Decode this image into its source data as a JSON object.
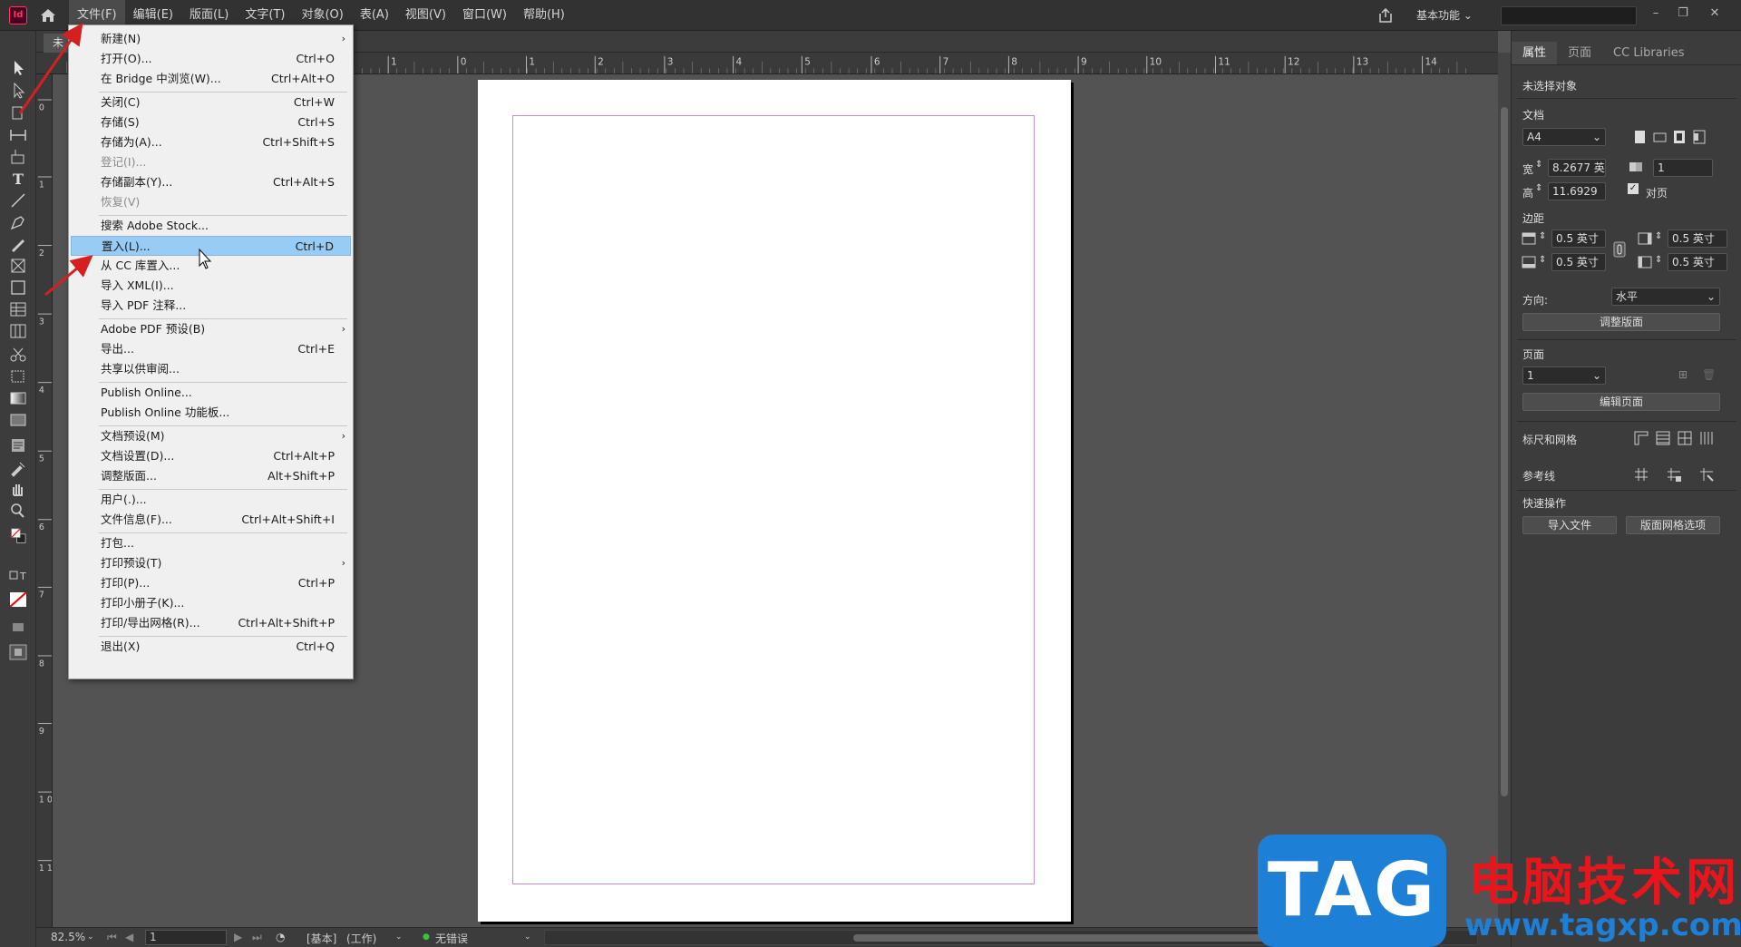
{
  "app": {
    "logo_text": "Id"
  },
  "menubar": {
    "items": [
      "文件(F)",
      "编辑(E)",
      "版面(L)",
      "文字(T)",
      "对象(O)",
      "表(A)",
      "视图(V)",
      "窗口(W)",
      "帮助(H)"
    ],
    "workspace": "基本功能"
  },
  "document_tab": "未",
  "file_menu": {
    "groups": [
      [
        {
          "label": "新建(N)",
          "shortcut": "",
          "submenu": true
        },
        {
          "label": "打开(O)...",
          "shortcut": "Ctrl+O"
        },
        {
          "label": "在 Bridge 中浏览(W)...",
          "shortcut": "Ctrl+Alt+O"
        }
      ],
      [
        {
          "label": "关闭(C)",
          "shortcut": "Ctrl+W"
        },
        {
          "label": "存储(S)",
          "shortcut": "Ctrl+S"
        },
        {
          "label": "存储为(A)...",
          "shortcut": "Ctrl+Shift+S"
        },
        {
          "label": "登记(I)...",
          "shortcut": "",
          "disabled": true
        },
        {
          "label": "存储副本(Y)...",
          "shortcut": "Ctrl+Alt+S"
        },
        {
          "label": "恢复(V)",
          "shortcut": "",
          "disabled": true
        }
      ],
      [
        {
          "label": "搜索 Adobe Stock...",
          "shortcut": ""
        },
        {
          "label": "置入(L)...",
          "shortcut": "Ctrl+D",
          "highlighted": true
        },
        {
          "label": "从 CC 库置入...",
          "shortcut": ""
        },
        {
          "label": "导入 XML(I)...",
          "shortcut": ""
        },
        {
          "label": "导入 PDF 注释...",
          "shortcut": ""
        }
      ],
      [
        {
          "label": "Adobe PDF 预设(B)",
          "shortcut": "",
          "submenu": true
        },
        {
          "label": "导出...",
          "shortcut": "Ctrl+E"
        },
        {
          "label": "共享以供审阅...",
          "shortcut": ""
        }
      ],
      [
        {
          "label": "Publish Online...",
          "shortcut": ""
        },
        {
          "label": "Publish Online 功能板...",
          "shortcut": ""
        }
      ],
      [
        {
          "label": "文档预设(M)",
          "shortcut": "",
          "submenu": true
        },
        {
          "label": "文档设置(D)...",
          "shortcut": "Ctrl+Alt+P"
        },
        {
          "label": "调整版面...",
          "shortcut": "Alt+Shift+P"
        }
      ],
      [
        {
          "label": "用户(.)...",
          "shortcut": ""
        },
        {
          "label": "文件信息(F)...",
          "shortcut": "Ctrl+Alt+Shift+I"
        }
      ],
      [
        {
          "label": "打包...",
          "shortcut": ""
        },
        {
          "label": "打印预设(T)",
          "shortcut": "",
          "submenu": true
        },
        {
          "label": "打印(P)...",
          "shortcut": "Ctrl+P"
        },
        {
          "label": "打印小册子(K)...",
          "shortcut": ""
        },
        {
          "label": "打印/导出网格(R)...",
          "shortcut": "Ctrl+Alt+Shift+P"
        }
      ],
      [
        {
          "label": "退出(X)",
          "shortcut": "Ctrl+Q"
        }
      ]
    ]
  },
  "rulers": {
    "horizontal": [
      "1",
      "0",
      "1",
      "2",
      "3",
      "4",
      "5",
      "6",
      "7",
      "8",
      "9",
      "10",
      "11",
      "12",
      "13",
      "14"
    ],
    "vertical": [
      "0",
      "1",
      "2",
      "3",
      "4",
      "5",
      "6",
      "7",
      "8",
      "9",
      "1 0",
      "1 1"
    ]
  },
  "panel": {
    "tabs": [
      "属性",
      "页面",
      "CC Libraries"
    ],
    "no_selection": "未选择对象",
    "document_label": "文档",
    "page_size": "A4",
    "width_label": "宽",
    "width_value": "8.2677 英",
    "height_label": "高",
    "height_value": "11.6929",
    "pages_value": "1",
    "facing_pages": "对页",
    "margins_label": "边距",
    "margin_top": "0.5 英寸",
    "margin_bottom": "0.5 英寸",
    "margin_right": "0.5 英寸",
    "margin_left": "0.5 英寸",
    "direction_label": "方向:",
    "direction_value": "水平",
    "adjust_layout": "调整版面",
    "page_label": "页面",
    "page_value": "1",
    "edit_page": "编辑页面",
    "rulers_grids": "标尺和网格",
    "guides": "参考线",
    "quick_actions": "快速操作",
    "import_file": "导入文件",
    "layout_grid_options": "版面网格选项"
  },
  "status": {
    "zoom": "82.5%",
    "page": "1",
    "style": "[基本]",
    "mode": "(工作)",
    "errors": "无错误"
  },
  "watermark": {
    "tag": "TAG",
    "cn": "电脑技术网",
    "url": "www.tagxp.com"
  },
  "colors": {
    "highlight": "#99ccf5",
    "margin_guide": "#c68cd6",
    "arrow": "#d42020",
    "watermark_blue": "#1e7fd6",
    "watermark_red": "#e8161c"
  }
}
